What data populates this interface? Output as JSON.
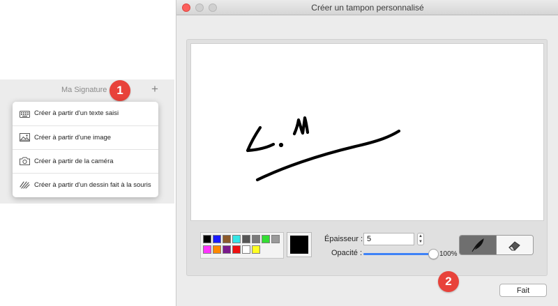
{
  "left_panel": {
    "title": "Ma Signature",
    "add_symbol": "+",
    "menu": [
      {
        "label": "Créer à partir d'un texte saisi",
        "icon": "keyboard-icon"
      },
      {
        "label": "Créer à partir d'une image",
        "icon": "image-icon"
      },
      {
        "label": "Créer à partir de la caméra",
        "icon": "camera-icon"
      },
      {
        "label": "Créer à partir d'un dessin fait à la souris",
        "icon": "scribble-icon"
      }
    ]
  },
  "badges": {
    "step1": "1",
    "step2": "2",
    "color": "#e8423a"
  },
  "dialog": {
    "title": "Créer un tampon personnalisé",
    "drawing": "handwritten L.M signature stroke",
    "palette": {
      "colors": [
        "#000000",
        "#1a1aff",
        "#8b5a2b",
        "#33e6e6",
        "#555555",
        "#7a7a7a",
        "#33dd33",
        "#9a9a9a",
        "#ff33ff",
        "#ff8800",
        "#7a1a8c",
        "#ee1111",
        "#ffffff",
        "#ffff22"
      ],
      "current": "#000000"
    },
    "thickness_label": "Épaisseur :",
    "thickness_value": "5",
    "opacity_label": "Opacité :",
    "opacity_value": "100%",
    "opacity_level": 1.0,
    "tools": [
      {
        "name": "pen",
        "icon": "feather-pen-icon",
        "selected": true
      },
      {
        "name": "eraser",
        "icon": "eraser-icon",
        "selected": false
      }
    ],
    "done_label": "Fait"
  }
}
